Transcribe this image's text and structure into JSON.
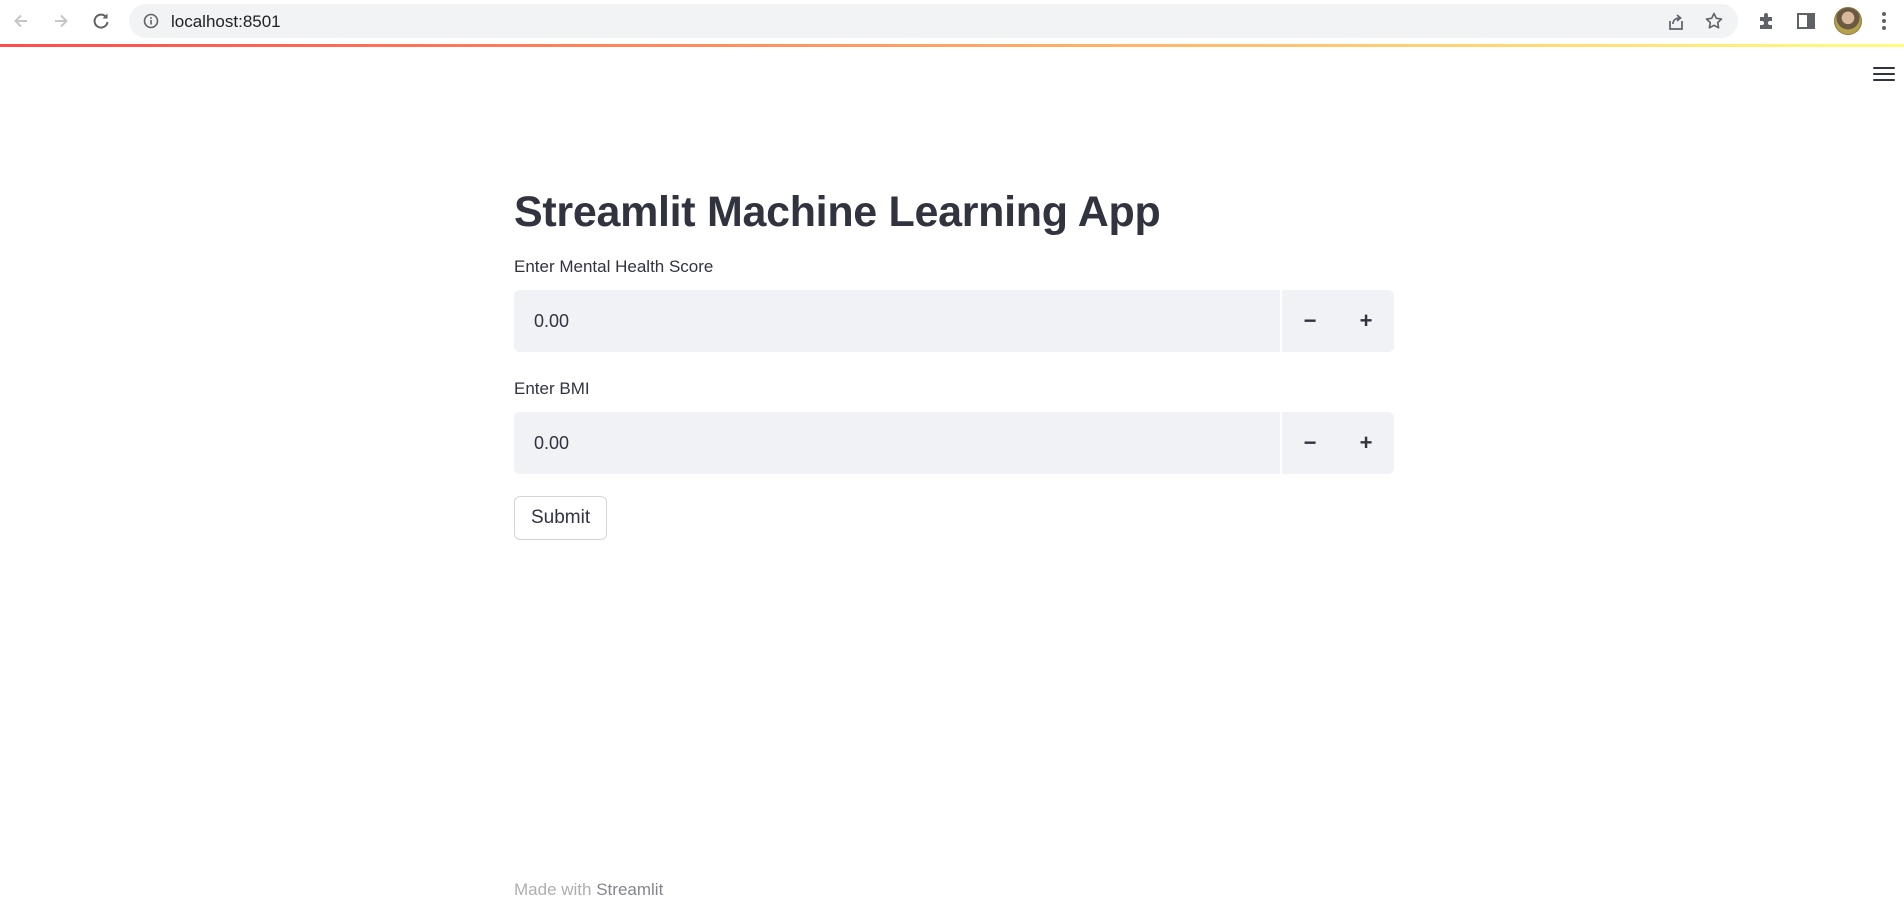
{
  "browser": {
    "url": "localhost:8501",
    "icons": {
      "back": "arrow-left-icon",
      "forward": "arrow-right-icon",
      "reload": "reload-icon",
      "info": "info-icon",
      "share": "share-icon",
      "bookmark": "star-icon",
      "extensions": "puzzle-icon",
      "side_panel": "side-panel-icon",
      "menu": "kebab-menu-icon"
    }
  },
  "app": {
    "title": "Streamlit Machine Learning App",
    "accent_colors": [
      "#ff4b4b",
      "#fffd80"
    ],
    "inputs": [
      {
        "label": "Enter Mental Health Score",
        "value": "0.00",
        "decrement": "−",
        "increment": "+"
      },
      {
        "label": "Enter BMI",
        "value": "0.00",
        "decrement": "−",
        "increment": "+"
      }
    ],
    "submit_label": "Submit"
  },
  "footer": {
    "prefix": "Made with",
    "brand": "Streamlit"
  }
}
